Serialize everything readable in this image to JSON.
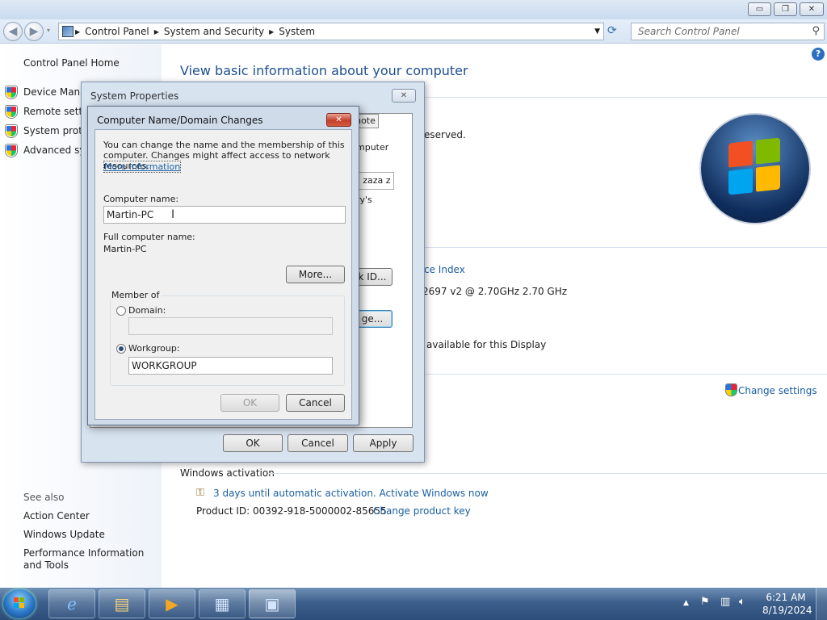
{
  "window": {
    "minimize": "▭",
    "restore": "❐",
    "close": "✕"
  },
  "address": {
    "crumbs": [
      "Control Panel",
      "System and Security",
      "System"
    ],
    "search_placeholder": "Search Control Panel"
  },
  "leftpane": {
    "home": "Control Panel Home",
    "items": [
      "Device Manager",
      "Remote settings",
      "System protection",
      "Advanced system settings"
    ],
    "see_also_heading": "See also",
    "see_also": [
      "Action Center",
      "Windows Update",
      "Performance Information and Tools"
    ]
  },
  "main": {
    "title": "View basic information about your computer",
    "copyright_tail": "eserved.",
    "rating_link_tail": "ce Index",
    "processor_tail": "2697 v2 @ 2.70GHz   2.70 GHz",
    "pen_touch_tail": "available for this Display",
    "change_settings": "Change settings",
    "activation_heading": "Windows activation",
    "activation_text": "3 days until automatic activation. Activate Windows now",
    "product_id": "Product ID: 00392-918-5000002-85655",
    "change_key": "Change product key"
  },
  "sysprops": {
    "title": "System Properties",
    "close": "✕",
    "tab_partial": "note",
    "behind_texts": [
      "mputer",
      "a zaza z",
      "ry's",
      "k ID...",
      "ge..."
    ],
    "ok": "OK",
    "cancel": "Cancel",
    "apply": "Apply"
  },
  "cndlg": {
    "title": "Computer Name/Domain Changes",
    "close": "✕",
    "intro": "You can change the name and the membership of this computer. Changes might affect access to network resources.",
    "more_info": "More information",
    "computer_name_label": "Computer name:",
    "computer_name_value": "Martin-PC",
    "full_name_label": "Full computer name:",
    "full_name_value": "Martin-PC",
    "more_button": "More...",
    "member_of": "Member of",
    "domain_label": "Domain:",
    "domain_value": "",
    "workgroup_label": "Workgroup:",
    "workgroup_value": "WORKGROUP",
    "ok": "OK",
    "cancel": "Cancel"
  },
  "taskbar": {
    "time": "6:21 AM",
    "date": "8/19/2024"
  },
  "colors": {
    "link": "#1a5ea3",
    "title": "#1d4f91",
    "taskbar": "#3d5f8c"
  }
}
